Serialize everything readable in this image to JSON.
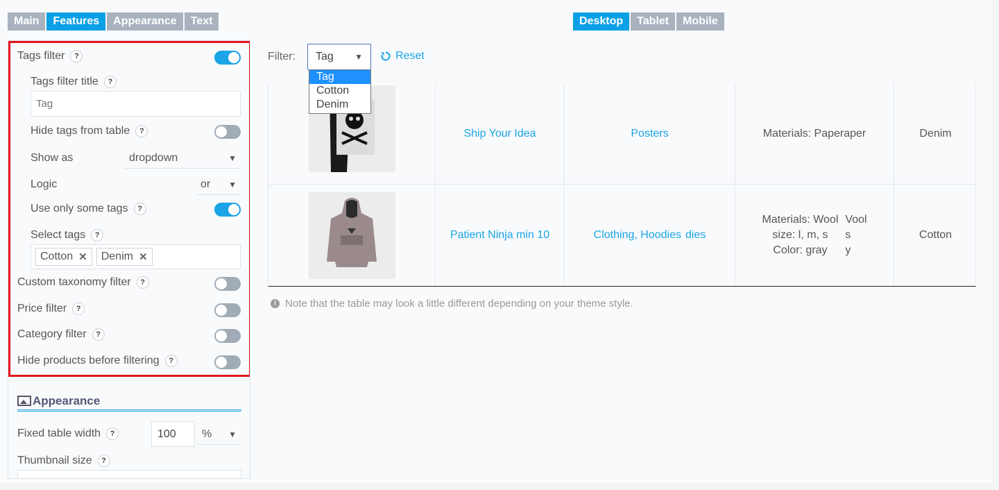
{
  "tabs_left": [
    "Main",
    "Features",
    "Appearance",
    "Text"
  ],
  "tabs_right": [
    "Desktop",
    "Tablet",
    "Mobile"
  ],
  "sidebar": {
    "tags_filter": "Tags filter",
    "tags_filter_title": "Tags filter title",
    "tags_filter_title_placeholder": "Tag",
    "hide_tags": "Hide tags from table",
    "show_as": "Show as",
    "show_as_value": "dropdown",
    "logic": "Logic",
    "logic_value": "or",
    "use_only_some": "Use only some tags",
    "select_tags": "Select tags",
    "selected_tags": [
      "Cotton",
      "Denim"
    ],
    "custom_taxonomy": "Custom taxonomy filter",
    "price_filter": "Price filter",
    "category_filter": "Category filter",
    "hide_products": "Hide products before filtering",
    "appearance_title": "Appearance",
    "fixed_width": "Fixed table width",
    "fixed_width_value": "100",
    "fixed_width_unit": "%",
    "thumbnail_size": "Thumbnail size",
    "help": "?",
    "remove": "✕"
  },
  "preview": {
    "filter_label": "Filter:",
    "filter_value": "Tag",
    "reset": "Reset",
    "options": [
      "Tag",
      "Cotton",
      "Denim"
    ],
    "rows": [
      {
        "name": "Ship Your Idea",
        "category": "Posters",
        "attr1": "Materials: Paper",
        "attr1_overflow": "aper",
        "tag": "Denim"
      },
      {
        "name": "Patient Ninja min 10",
        "category": "Clothing, Hoodies",
        "category_overflow": "dies",
        "attr_lines": [
          "Materials: Wool",
          "size: l, m, s",
          "Color: gray"
        ],
        "attr_overflow": [
          "Vool",
          "s",
          "y"
        ],
        "tag": "Cotton"
      }
    ],
    "note": "Note that the table may look a little different depending on your theme style."
  }
}
